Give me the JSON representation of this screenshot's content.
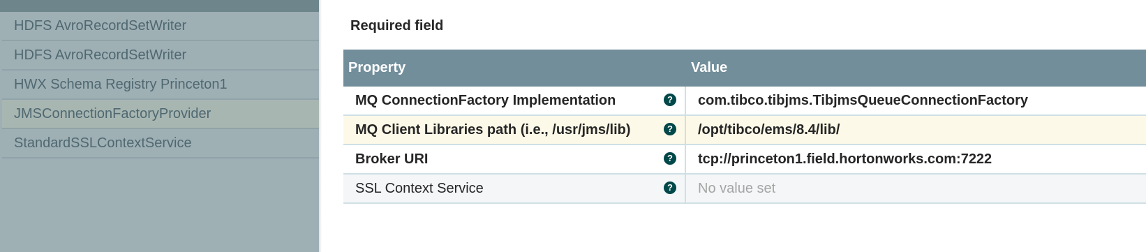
{
  "left_panel": {
    "items": [
      {
        "label": "HDFS AvroRecordSetWriter"
      },
      {
        "label": "HDFS AvroRecordSetWriter"
      },
      {
        "label": "HWX Schema Registry Princeton1"
      },
      {
        "label": "JMSConnectionFactoryProvider"
      },
      {
        "label": "StandardSSLContextService"
      }
    ]
  },
  "main": {
    "required_field_label": "Required field",
    "table": {
      "headers": {
        "property": "Property",
        "value": "Value"
      },
      "rows": [
        {
          "name": "MQ ConnectionFactory Implementation",
          "value": "com.tibco.tibjms.TibjmsQueueConnectionFactory",
          "help_icon": "question-circle-icon"
        },
        {
          "name": "MQ Client Libraries path (i.e., /usr/jms/lib)",
          "value": "/opt/tibco/ems/8.4/lib/",
          "help_icon": "question-circle-icon"
        },
        {
          "name": "Broker URI",
          "value": "tcp://princeton1.field.hortonworks.com:7222",
          "help_icon": "question-circle-icon"
        },
        {
          "name": "SSL Context Service",
          "value": "No value set",
          "help_icon": "question-circle-icon"
        }
      ]
    }
  },
  "colors": {
    "table_header_bg": "#728e9b",
    "help_icon_bg": "#004849",
    "highlight_row_bg": "#fdf9e8",
    "left_panel_bg": "#9fb0b5"
  }
}
